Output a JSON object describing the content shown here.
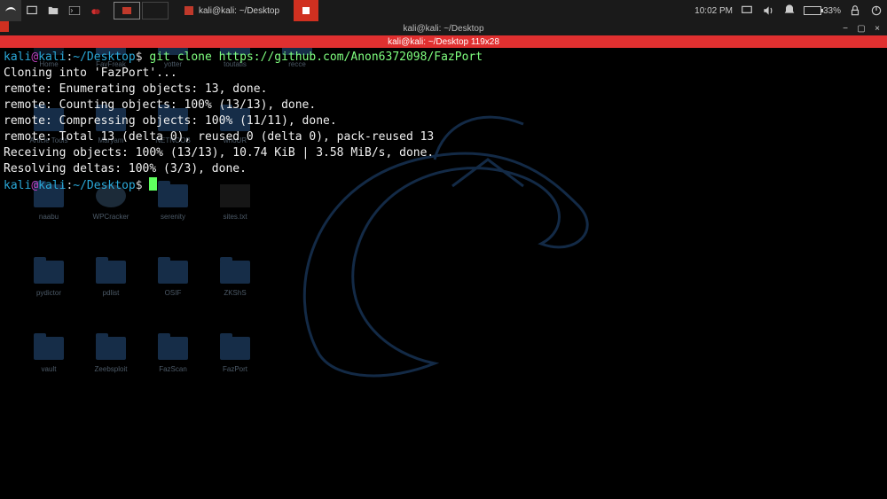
{
  "taskbar": {
    "task_label": "kali@kali: ~/Desktop",
    "time": "10:02 PM",
    "battery": "33%"
  },
  "terminal": {
    "title": "kali@kali: ~/Desktop",
    "tab": "kali@kali: ~/Desktop 119x28",
    "prompt_user": "kali",
    "prompt_at": "@",
    "prompt_host": "kali",
    "prompt_colon": ":",
    "prompt_path": "~/Desktop",
    "prompt_dollar": "$",
    "command1": " git clone https://github.com/Anon6372098/FazPort",
    "lines": [
      "Cloning into 'FazPort'...",
      "remote: Enumerating objects: 13, done.",
      "remote: Counting objects: 100% (13/13), done.",
      "remote: Compressing objects: 100% (11/11), done.",
      "remote: Total 13 (delta 0), reused 0 (delta 0), pack-reused 13",
      "Receiving objects: 100% (13/13), 10.74 KiB | 3.58 MiB/s, done.",
      "Resolving deltas: 100% (3/3), done."
    ]
  },
  "desktop": {
    "items": [
      {
        "label": "Home",
        "kind": "home"
      },
      {
        "label": "FavFreak",
        "kind": "fld"
      },
      {
        "label": "yotter",
        "kind": "fld"
      },
      {
        "label": "toutatis",
        "kind": "fld"
      },
      {
        "label": "recce",
        "kind": "fld"
      },
      {
        "label": "Article Tools",
        "kind": "fld"
      },
      {
        "label": "Maryam",
        "kind": "fld"
      },
      {
        "label": "NETNOOB",
        "kind": "fld"
      },
      {
        "label": "whoUR",
        "kind": "fld"
      },
      {
        "label": "",
        "kind": "blank"
      },
      {
        "label": "naabu",
        "kind": "fld"
      },
      {
        "label": "WPCracker",
        "kind": "gear"
      },
      {
        "label": "serenity",
        "kind": "fld"
      },
      {
        "label": "sites.txt",
        "kind": "file"
      },
      {
        "label": "",
        "kind": "blank"
      },
      {
        "label": "pydictor",
        "kind": "fld"
      },
      {
        "label": "pdlist",
        "kind": "fld"
      },
      {
        "label": "OSIF",
        "kind": "fld"
      },
      {
        "label": "ZKShS",
        "kind": "fld"
      },
      {
        "label": "",
        "kind": "blank"
      },
      {
        "label": "vault",
        "kind": "fld"
      },
      {
        "label": "Zeebsploit",
        "kind": "fld"
      },
      {
        "label": "FazScan",
        "kind": "fld"
      },
      {
        "label": "FazPort",
        "kind": "fld"
      }
    ]
  }
}
